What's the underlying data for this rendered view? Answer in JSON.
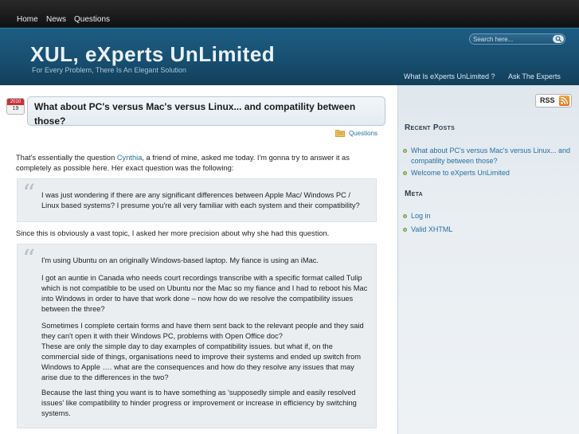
{
  "topnav": {
    "items": [
      "Home",
      "News",
      "Questions"
    ]
  },
  "header": {
    "title": "XUL, eXperts UnLimited",
    "tagline": "For Every Problem, There Is An Elegant Solution",
    "search_placeholder": "Search here...",
    "nav": [
      "What Is eXperts UnLimited ?",
      "Ask The Experts"
    ]
  },
  "post": {
    "date_month": "2010",
    "date_day": "19",
    "title": "What about PC's versus Mac's versus Linux... and compatility between those?",
    "category": "Questions",
    "intro_before": "That's essentially the question ",
    "intro_link": "Cynthia",
    "intro_after": ", a friend of mine, asked me today. I'm gonna try to answer it as completely as possible here. Her exact question was the following:",
    "quote1": "I was just wondering if there are any significant differences between Apple Mac/ Windows PC / Linux based systems? I presume you're all very familiar with each system and their compatibility?",
    "middle": "Since this is obviously a vast topic, I asked her more precision about why she had this question.",
    "quote2": [
      "I'm using Ubuntu on an originally Windows-based laptop. My fiance is using an iMac.",
      "I got an auntie in Canada who needs court recordings transcribe with a specific format called Tulip which is not compatible to be used on Ubuntu nor the Mac so my fiance and I had to reboot his Mac into Windows in order to have that work done – now how do we resolve the compatibility issues between the three?",
      "Sometimes I complete certain forms and have them sent back to the relevant people and they said they can't open it with their Windows PC, problems with Open Office doc?",
      "These are only the simple day to day examples of compatibility issues. but what if, on the commercial side of things, organisations need to improve their systems and ended up switch from Windows to Apple …. what are the consequences and how do they resolve any issues that may arise due to the differences in the two?",
      "Because the last thing you want is to have something as 'supposedly simple and easily resolved issues' like compatibility to hinder progress or improvement or increase in efficiency by switching systems."
    ]
  },
  "sidebar": {
    "rss_label": "RSS",
    "recent_title": "Recent Posts",
    "recent": [
      "What about PC's versus Mac's versus Linux... and compatility between those?",
      "Welcome to eXperts UnLimited"
    ],
    "meta_title": "Meta",
    "meta": [
      "Log in",
      "Valid XHTML"
    ]
  },
  "colors": {
    "header": "#1d5d83",
    "link": "#26709f",
    "rss": "#e0731a"
  }
}
